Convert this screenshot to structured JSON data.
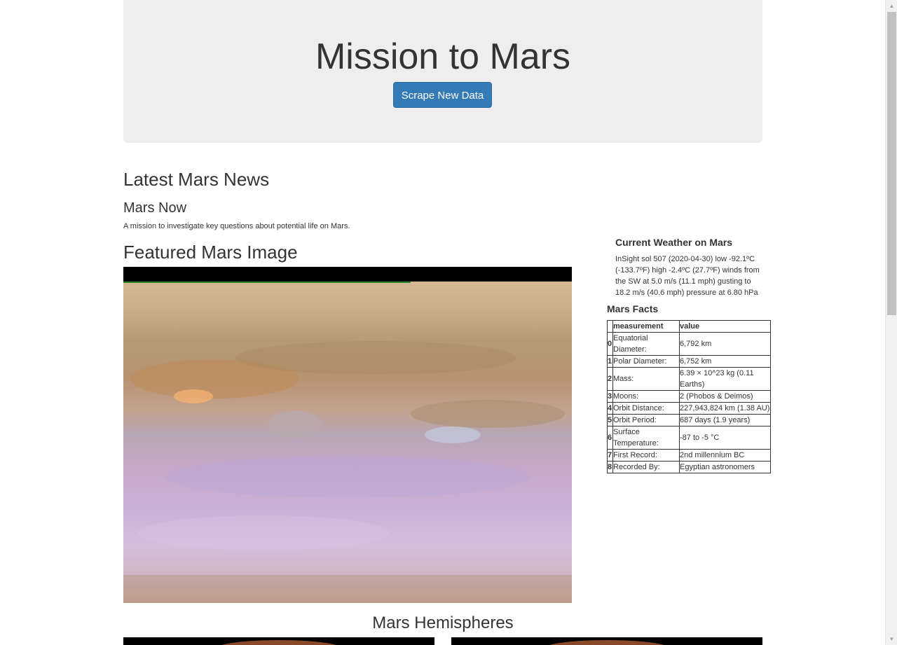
{
  "jumbotron": {
    "title": "Mission to Mars",
    "button_label": "Scrape New Data",
    "button_color": "#337ab7"
  },
  "news": {
    "heading": "Latest Mars News",
    "title": "Mars Now",
    "paragraph": "A mission to investigate key questions about potential life on Mars."
  },
  "featured": {
    "heading": "Featured Mars Image",
    "image_alt": "Jupiter cloud bands image"
  },
  "weather": {
    "heading": "Current Weather on Mars",
    "text": "InSight sol 507 (2020-04-30) low -92.1ºC (-133.7ºF) high -2.4ºC (27.7ºF) winds from the SW at 5.0 m/s (11.1 mph) gusting to 18.2 m/s (40.6 mph) pressure at 6.80 hPa"
  },
  "facts": {
    "heading": "Mars Facts",
    "columns": [
      "measurement",
      "value"
    ],
    "rows": [
      {
        "index": "0",
        "measurement": "Equatorial Diameter:",
        "value": "6,792 km"
      },
      {
        "index": "1",
        "measurement": "Polar Diameter:",
        "value": "6,752 km"
      },
      {
        "index": "2",
        "measurement": "Mass:",
        "value": "6.39 × 10^23 kg (0.11 Earths)"
      },
      {
        "index": "3",
        "measurement": "Moons:",
        "value": "2 (Phobos & Deimos)"
      },
      {
        "index": "4",
        "measurement": "Orbit Distance:",
        "value": "227,943,824 km (1.38 AU)"
      },
      {
        "index": "5",
        "measurement": "Orbit Period:",
        "value": "687 days (1.9 years)"
      },
      {
        "index": "6",
        "measurement": "Surface Temperature:",
        "value": "-87 to -5 °C"
      },
      {
        "index": "7",
        "measurement": "First Record:",
        "value": "2nd millennium BC"
      },
      {
        "index": "8",
        "measurement": "Recorded By:",
        "value": "Egyptian astronomers"
      }
    ]
  },
  "hemispheres": {
    "heading": "Mars Hemispheres"
  }
}
